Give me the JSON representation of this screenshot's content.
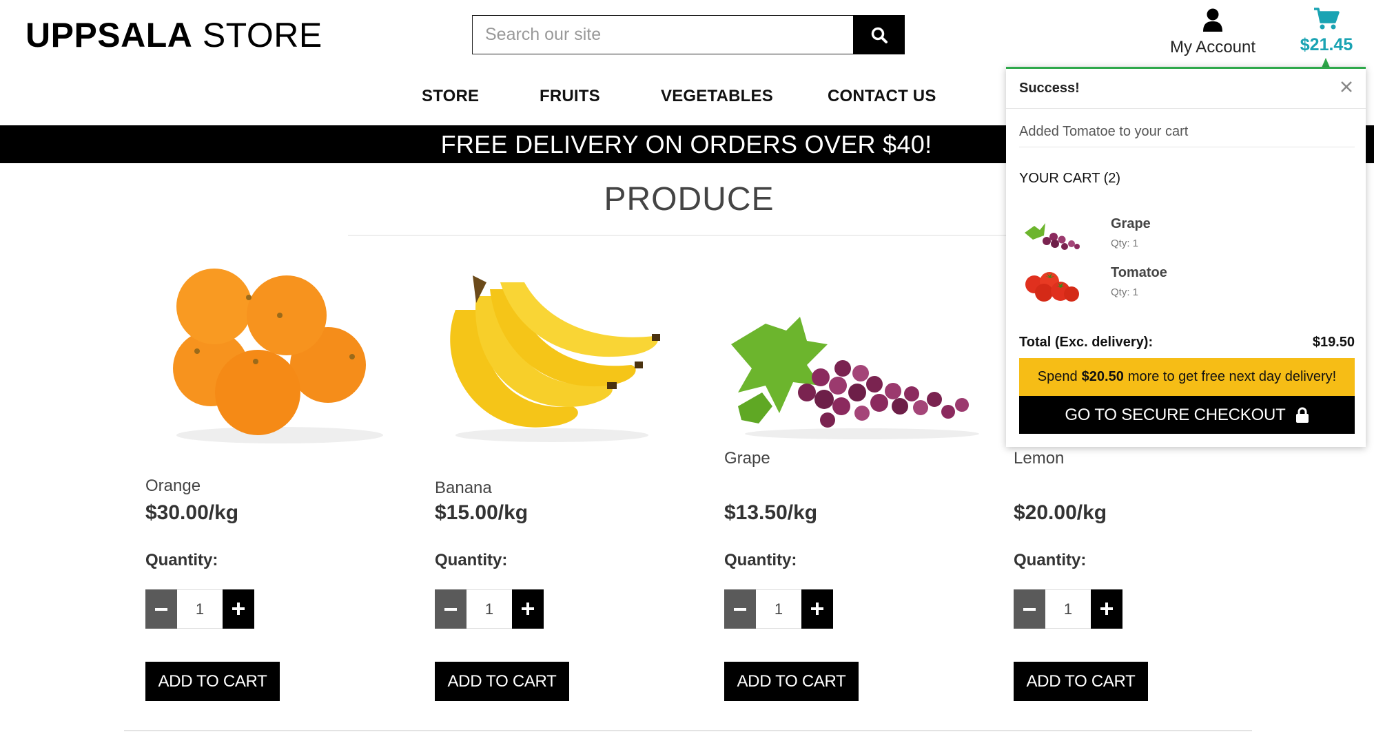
{
  "header": {
    "logo_bold": "UPPSALA",
    "logo_light": "STORE",
    "search_placeholder": "Search our site",
    "account_label": "My Account",
    "cart_total": "$21.45"
  },
  "nav": {
    "items": [
      "STORE",
      "FRUITS",
      "VEGETABLES",
      "CONTACT US"
    ]
  },
  "banner": {
    "text": "FREE DELIVERY ON ORDERS OVER $40!"
  },
  "page": {
    "title": "PRODUCE"
  },
  "products": [
    {
      "name": "Orange",
      "price": "$30.00/kg",
      "qty_label": "Quantity:",
      "qty": "1",
      "button": "ADD TO CART"
    },
    {
      "name": "Banana",
      "price": "$15.00/kg",
      "qty_label": "Quantity:",
      "qty": "1",
      "button": "ADD TO CART"
    },
    {
      "name": "Grape",
      "price": "$13.50/kg",
      "qty_label": "Quantity:",
      "qty": "1",
      "button": "ADD TO CART"
    },
    {
      "name": "Lemon",
      "price": "$20.00/kg",
      "qty_label": "Quantity:",
      "qty": "1",
      "button": "ADD TO CART"
    }
  ],
  "cart_toast": {
    "status": "Success!",
    "message": "Added Tomatoe to your cart",
    "cart_title": "YOUR CART (2)",
    "items": [
      {
        "name": "Grape",
        "qty": "Qty: 1"
      },
      {
        "name": "Tomatoe",
        "qty": "Qty: 1"
      }
    ],
    "total_label": "Total (Exc. delivery):",
    "total_value": "$19.50",
    "promo_before": "Spend",
    "promo_amount": "$20.50",
    "promo_after": "more to get free next day delivery!",
    "checkout_label": "GO TO SECURE CHECKOUT"
  },
  "colors": {
    "accent_cyan": "#1aa3b3",
    "success_green": "#2ea84a",
    "promo_yellow": "#f6bd16",
    "primary_black": "#000000"
  },
  "icons": [
    "search-icon",
    "user-icon",
    "cart-icon",
    "close-icon",
    "minus-icon",
    "plus-icon",
    "lock-icon"
  ]
}
